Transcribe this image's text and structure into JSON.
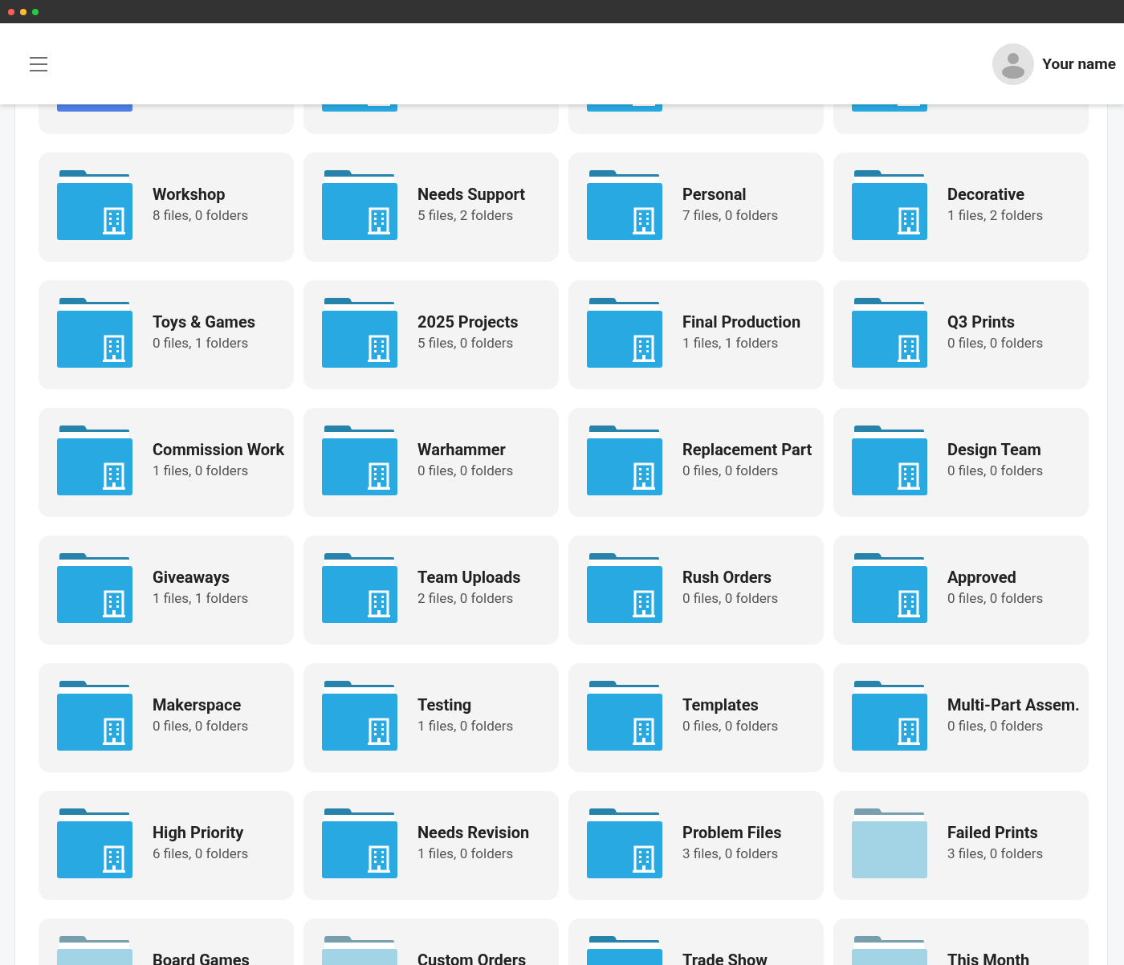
{
  "header": {
    "user_name": "Your name"
  },
  "folders": [
    {
      "kind": "plain",
      "color": "#4f80e8"
    },
    {
      "kind": "shared",
      "color": "#29a9e1"
    },
    {
      "kind": "shared",
      "color": "#29a9e1"
    },
    {
      "kind": "shared",
      "color": "#29a9e1"
    },
    {
      "kind": "shared",
      "color": "#29a9e1",
      "name": "Workshop",
      "counts": "8 files, 0 folders"
    },
    {
      "kind": "shared",
      "color": "#29a9e1",
      "name": "Needs Support",
      "counts": "5 files, 2 folders"
    },
    {
      "kind": "shared",
      "color": "#29a9e1",
      "name": "Personal",
      "counts": "7 files, 0 folders"
    },
    {
      "kind": "shared",
      "color": "#29a9e1",
      "name": "Decorative",
      "counts": "1 files, 2 folders"
    },
    {
      "kind": "shared",
      "color": "#29a9e1",
      "name": "Toys & Games",
      "counts": "0 files, 1 folders"
    },
    {
      "kind": "shared",
      "color": "#29a9e1",
      "name": "2025 Projects",
      "counts": "5 files, 0 folders"
    },
    {
      "kind": "shared",
      "color": "#29a9e1",
      "name": "Final Production",
      "counts": "1 files, 1 folders"
    },
    {
      "kind": "shared",
      "color": "#29a9e1",
      "name": "Q3 Prints",
      "counts": "0 files, 0 folders"
    },
    {
      "kind": "shared",
      "color": "#29a9e1",
      "name": "Commission Work",
      "counts": "1 files, 0 folders"
    },
    {
      "kind": "shared",
      "color": "#29a9e1",
      "name": "Warhammer",
      "counts": "0 files, 0 folders"
    },
    {
      "kind": "shared",
      "color": "#29a9e1",
      "name": "Replacement Part",
      "counts": "0 files, 0 folders"
    },
    {
      "kind": "shared",
      "color": "#29a9e1",
      "name": "Design Team",
      "counts": "0 files, 0 folders"
    },
    {
      "kind": "shared",
      "color": "#29a9e1",
      "name": "Giveaways",
      "counts": "1 files, 1 folders"
    },
    {
      "kind": "shared",
      "color": "#29a9e1",
      "name": "Team Uploads",
      "counts": "2 files, 0 folders"
    },
    {
      "kind": "shared",
      "color": "#29a9e1",
      "name": "Rush Orders",
      "counts": "0 files, 0 folders"
    },
    {
      "kind": "shared",
      "color": "#29a9e1",
      "name": "Approved",
      "counts": "0 files, 0 folders"
    },
    {
      "kind": "shared",
      "color": "#29a9e1",
      "name": "Makerspace",
      "counts": "0 files, 0 folders"
    },
    {
      "kind": "shared",
      "color": "#29a9e1",
      "name": "Testing",
      "counts": "1 files, 0 folders"
    },
    {
      "kind": "shared",
      "color": "#29a9e1",
      "name": "Templates",
      "counts": "0 files, 0 folders"
    },
    {
      "kind": "shared",
      "color": "#29a9e1",
      "name": "Multi-Part Assem.",
      "counts": "0 files, 0 folders"
    },
    {
      "kind": "shared",
      "color": "#29a9e1",
      "name": "High Priority",
      "counts": "6 files, 0 folders"
    },
    {
      "kind": "shared",
      "color": "#29a9e1",
      "name": "Needs Revision",
      "counts": "1 files, 0 folders"
    },
    {
      "kind": "shared",
      "color": "#29a9e1",
      "name": "Problem Files",
      "counts": "3 files, 0 folders"
    },
    {
      "kind": "plain",
      "color": "#a3d4e6",
      "name": "Failed Prints",
      "counts": "3 files, 0 folders"
    },
    {
      "kind": "plain",
      "color": "#a3d4e6",
      "name": "Board Games"
    },
    {
      "kind": "plain",
      "color": "#a3d4e6",
      "name": "Custom Orders"
    },
    {
      "kind": "shared",
      "color": "#29a9e1",
      "name": "Trade Show"
    },
    {
      "kind": "plain",
      "color": "#a3d4e6",
      "name": "This Month"
    }
  ]
}
